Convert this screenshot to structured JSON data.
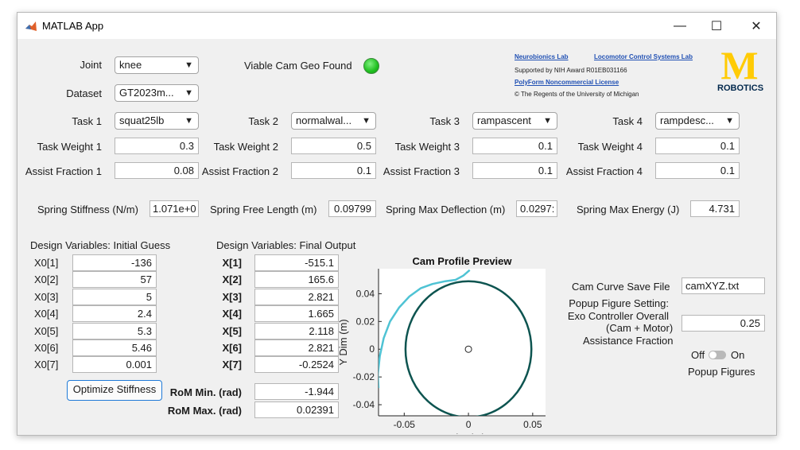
{
  "window": {
    "title": "MATLAB App",
    "minimize": "—",
    "maximize": "☐",
    "close": "✕"
  },
  "joint": {
    "label": "Joint",
    "value": "knee"
  },
  "dataset": {
    "label": "Dataset",
    "value": "GT2023m..."
  },
  "viable": {
    "label": "Viable Cam Geo Found",
    "lamp_color": "#22c022"
  },
  "tasks": [
    {
      "label": "Task 1",
      "value": "squat25lb",
      "weight_label": "Task Weight 1",
      "weight": "0.3",
      "assist_label": "Assist Fraction 1",
      "assist": "0.08"
    },
    {
      "label": "Task 2",
      "value": "normalwal...",
      "weight_label": "Task Weight 2",
      "weight": "0.5",
      "assist_label": "Assist Fraction 2",
      "assist": "0.1"
    },
    {
      "label": "Task 3",
      "value": "rampascent",
      "weight_label": "Task Weight 3",
      "weight": "0.1",
      "assist_label": "Assist Fraction 3",
      "assist": "0.1"
    },
    {
      "label": "Task 4",
      "value": "rampdesc...",
      "weight_label": "Task Weight 4",
      "weight": "0.1",
      "assist_label": "Assist Fraction 4",
      "assist": "0.1"
    }
  ],
  "spring": {
    "stiffness_label": "Spring Stiffness (N/m)",
    "stiffness": "1.071e+0",
    "free_length_label": "Spring Free Length (m)",
    "free_length": "0.09799",
    "max_deflection_label": "Spring Max Deflection (m)",
    "max_deflection": "0.0297:",
    "max_energy_label": "Spring Max Energy (J)",
    "max_energy": "4.731"
  },
  "credits": {
    "lab1": "Neurobionics Lab",
    "lab2": "Locomotor Control Systems Lab",
    "grant": "Supported by NIH Award R01EB031166",
    "license": "PolyForm Noncommercial License",
    "copyright": "© The Regents of the University of Michigan",
    "logo_letter": "M",
    "logo_text": "ROBOTICS",
    "logo_color": "#ffcb05"
  },
  "initial_guess": {
    "heading": "Design Variables: Initial Guess",
    "rows": [
      {
        "label": "X0[1]",
        "value": "-136"
      },
      {
        "label": "X0[2]",
        "value": "57"
      },
      {
        "label": "X0[3]",
        "value": "5"
      },
      {
        "label": "X0[4]",
        "value": "2.4"
      },
      {
        "label": "X0[5]",
        "value": "5.3"
      },
      {
        "label": "X0[6]",
        "value": "5.46"
      },
      {
        "label": "X0[7]",
        "value": "0.001"
      }
    ]
  },
  "final_output": {
    "heading": "Design Variables: Final Output",
    "rows": [
      {
        "label": "X[1]",
        "value": "-515.1"
      },
      {
        "label": "X[2]",
        "value": "165.6"
      },
      {
        "label": "X[3]",
        "value": "2.821"
      },
      {
        "label": "X[4]",
        "value": "1.665"
      },
      {
        "label": "X[5]",
        "value": "2.118"
      },
      {
        "label": "X[6]",
        "value": "2.821"
      },
      {
        "label": "X[7]",
        "value": "-0.2524"
      }
    ]
  },
  "optimize_button": "Optimize Stiffness",
  "rom": {
    "min_label": "RoM Min. (rad)",
    "min": "-1.944",
    "max_label": "RoM Max. (rad)",
    "max": "0.02391"
  },
  "save": {
    "label": "Cam Curve Save File",
    "value": "camXYZ.txt"
  },
  "popup_setting": {
    "line1": "Popup Figure Setting:",
    "line2": "Exo Controller Overall",
    "line3": "(Cam + Motor)",
    "line4": "Assistance Fraction",
    "value": "0.25"
  },
  "popup_toggle": {
    "off": "Off",
    "on": "On",
    "label": "Popup Figures",
    "state": "off"
  },
  "chart_data": {
    "type": "line",
    "title": "Cam Profile Preview",
    "xlabel": "X Dim (m)",
    "ylabel": "Y Dim (m)",
    "xlim": [
      -0.07,
      0.06
    ],
    "ylim": [
      -0.048,
      0.058
    ],
    "xticks": [
      "-0.05",
      "0",
      "0.05"
    ],
    "yticks": [
      "-0.04",
      "-0.02",
      "0",
      "0.02",
      "0.04"
    ],
    "series": [
      {
        "kind": "circle",
        "center": [
          0,
          0
        ],
        "radius": 0.049,
        "color": "#0d5450"
      },
      {
        "kind": "point",
        "center": [
          0,
          0
        ],
        "color": "#222222"
      },
      {
        "kind": "curve",
        "color": "#4fc3d4",
        "points": [
          [
            -0.07,
            -0.028
          ],
          [
            -0.0705,
            -0.018
          ],
          [
            -0.069,
            -0.005
          ],
          [
            -0.066,
            0.008
          ],
          [
            -0.061,
            0.02
          ],
          [
            -0.054,
            0.03
          ],
          [
            -0.046,
            0.038
          ],
          [
            -0.037,
            0.044
          ],
          [
            -0.028,
            0.047
          ],
          [
            -0.018,
            0.049
          ],
          [
            -0.01,
            0.05
          ],
          [
            -0.004,
            0.053
          ],
          [
            0.001,
            0.057
          ]
        ]
      }
    ]
  }
}
